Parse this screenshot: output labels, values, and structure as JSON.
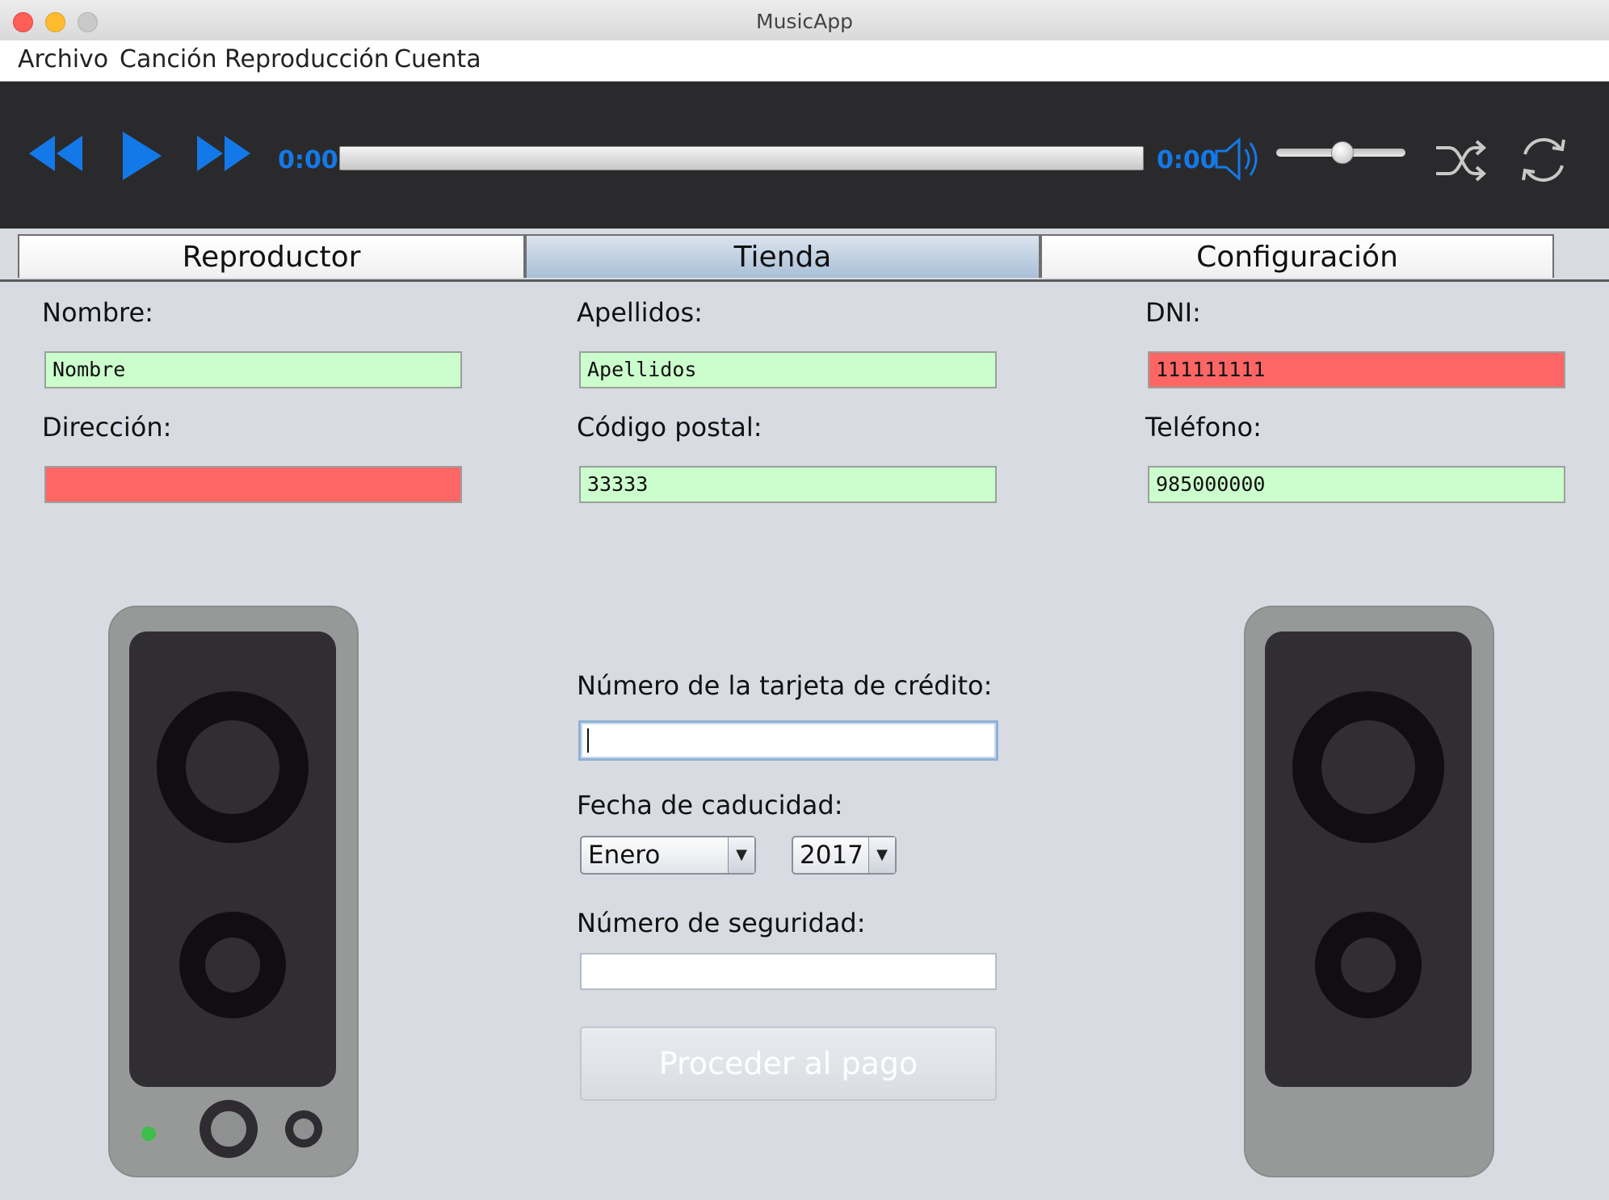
{
  "window": {
    "title": "MusicApp"
  },
  "menu": {
    "items": [
      "Archivo",
      "Canción",
      "Reproducción",
      "Cuenta"
    ]
  },
  "player": {
    "current_time": "0:00",
    "total_time": "0:00",
    "progress": 0,
    "volume": 0.5,
    "icons": [
      "rewind-icon",
      "play-icon",
      "fast-forward-icon",
      "volume-icon",
      "shuffle-icon",
      "repeat-icon"
    ],
    "accent_color": "#1479e8"
  },
  "tabs": [
    {
      "label": "Reproductor",
      "active": false
    },
    {
      "label": "Tienda",
      "active": true
    },
    {
      "label": "Configuración",
      "active": false
    }
  ],
  "form": {
    "nombre": {
      "label": "Nombre:",
      "value": "Nombre",
      "status": "valid"
    },
    "apellidos": {
      "label": "Apellidos:",
      "value": "Apellidos",
      "status": "valid"
    },
    "dni": {
      "label": "DNI:",
      "value": "111111111",
      "status": "invalid"
    },
    "direccion": {
      "label": "Dirección:",
      "value": "",
      "status": "invalid"
    },
    "codigo_postal": {
      "label": "Código postal:",
      "value": "33333",
      "status": "valid"
    },
    "telefono": {
      "label": "Teléfono:",
      "value": "985000000",
      "status": "valid"
    },
    "tarjeta": {
      "label": "Número de la tarjeta de crédito:",
      "value": ""
    },
    "caducidad": {
      "label": "Fecha de caducidad:",
      "month": "Enero",
      "year": "2017"
    },
    "seguridad": {
      "label": "Número de seguridad:",
      "value": ""
    },
    "pay_button": "Proceder al pago",
    "colors": {
      "valid": "#ccfdcc",
      "invalid": "#fe6666"
    }
  }
}
